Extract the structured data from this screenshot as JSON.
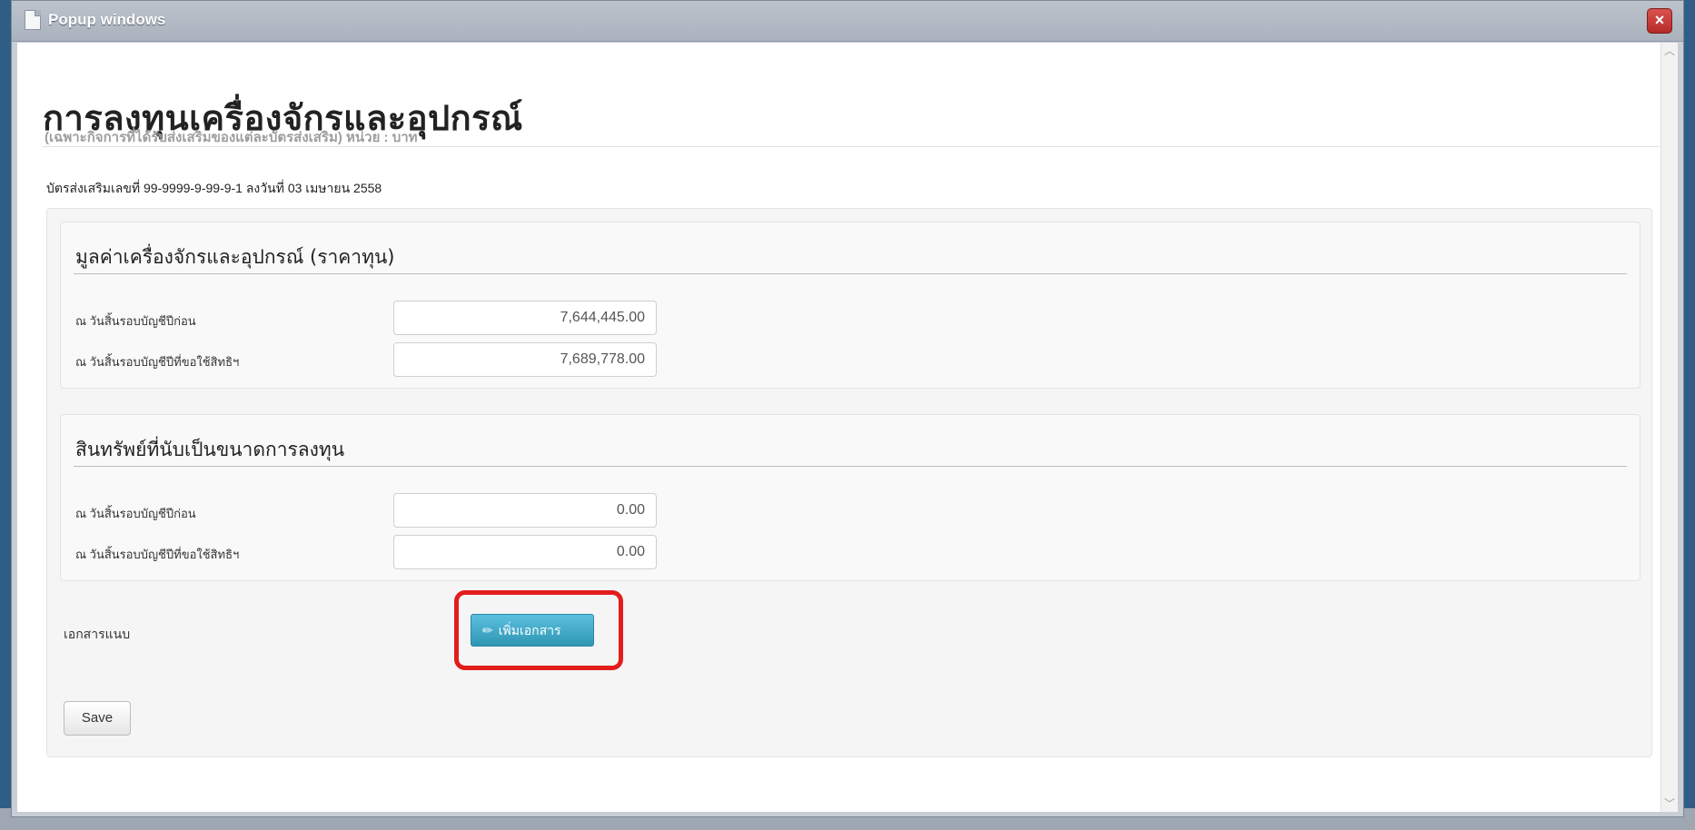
{
  "window": {
    "title": "Popup windows",
    "close_label": "×"
  },
  "page": {
    "title": "การลงทุนเครื่องจักรและอุปกรณ์",
    "subtitle": "(เฉพาะกิจการที่ได้รับส่งเสริมของแต่ละบัตรส่งเสริม) หน่วย : บาท",
    "certificate": "บัตรส่งเสริมเลขที่ 99-9999-9-99-9-1 ลงวันที่ 03 เมษายน 2558"
  },
  "section_machinery": {
    "title": "มูลค่าเครื่องจักรและอุปกรณ์ (ราคาทุน)",
    "rows": [
      {
        "label": "ณ วันสิ้นรอบบัญชีปีก่อน",
        "value": "7,644,445.00"
      },
      {
        "label": "ณ วันสิ้นรอบบัญชีปีที่ขอใช้สิทธิฯ",
        "value": "7,689,778.00"
      }
    ]
  },
  "section_assets": {
    "title": "สินทรัพย์ที่นับเป็นขนาดการลงทุน",
    "rows": [
      {
        "label": "ณ วันสิ้นรอบบัญชีปีก่อน",
        "value": "0.00"
      },
      {
        "label": "ณ วันสิ้นรอบบัญชีปีที่ขอใช้สิทธิฯ",
        "value": "0.00"
      }
    ]
  },
  "attachments": {
    "label": "เอกสารแนบ",
    "add_button": "เพิ่มเอกสาร",
    "add_icon": "pencil-icon",
    "highlight_color": "#e31c1c"
  },
  "actions": {
    "save": "Save"
  },
  "scrollbar": {
    "up": "︿",
    "down": "﹀"
  }
}
